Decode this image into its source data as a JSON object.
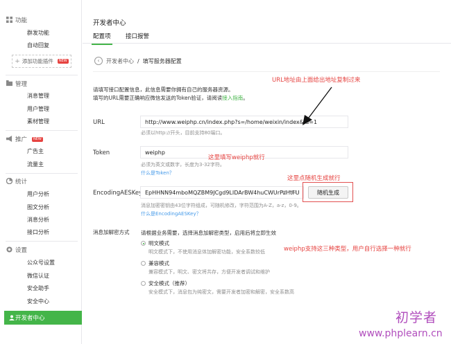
{
  "sidebar": {
    "groups": [
      {
        "title": "功能",
        "icon": "grid-icon",
        "items": [
          "群发功能",
          "自动回复"
        ]
      },
      {
        "title": "管理",
        "icon": "folder-icon",
        "items": [
          "消息管理",
          "用户管理",
          "素材管理"
        ]
      },
      {
        "title": "推广",
        "icon": "megaphone-icon",
        "badge": "NEW",
        "items": [
          "广告主",
          "流量主"
        ]
      },
      {
        "title": "统计",
        "icon": "chart-icon",
        "items": [
          "用户分析",
          "图文分析",
          "消息分析",
          "接口分析"
        ]
      },
      {
        "title": "设置",
        "icon": "gear-icon",
        "items": [
          "公众号设置",
          "微信认证",
          "安全助手",
          "安全中心"
        ]
      }
    ],
    "add_plugin": {
      "label": "添加功能插件",
      "badge": "NEW"
    },
    "active_item": "开发者中心",
    "accent": "#44b549"
  },
  "main": {
    "title": "开发者中心",
    "tabs": [
      {
        "label": "配置项"
      },
      {
        "label": "接口报警"
      }
    ],
    "breadcrumb": {
      "parent": "开发者中心",
      "separator": "/",
      "current": "填写服务器配置"
    },
    "intro_line1": "请填写接口配置信息，此信息需要你拥有自己的服务器资源。",
    "intro_line2_prefix": "填写的URL需要正确响应微信发送的Token验证，请阅读",
    "intro_link": "接入指南",
    "intro_suffix": "。",
    "url": {
      "label": "URL",
      "value": "http://www.weiphp.cn/index.php?s=/home/weixin/index&id=1",
      "hint": "必须以http://开头，目前支持80端口。"
    },
    "token": {
      "label": "Token",
      "value": "weiphp",
      "hint": "必须为英文或数字，长度为3-32字符。",
      "link": "什么是Token？"
    },
    "aes": {
      "label": "EncodingAESKey",
      "value": "EpHHNN94mboMQZBM9JCgd9LIDArBW4huCWUrPzHtFU",
      "counter": "43 /43",
      "button": "随机生成",
      "hint": "消息加密密钥由43位字符组成，可随机修改，字符范围为A-Z，a-z，0-9。",
      "link": "什么是EncodingAESKey？"
    },
    "encrypt": {
      "label": "消息加解密方式",
      "desc": "请根据业务需要，选择消息加解密类型，启用后将立即生效",
      "options": [
        {
          "label": "明文模式",
          "desc": "明文模式下，不使用消息体加解密功能，安全系数较低",
          "checked": true
        },
        {
          "label": "兼容模式",
          "desc": "兼容模式下，明文、密文将共存，方便开发者调试和维护",
          "checked": false
        },
        {
          "label": "安全模式（推荐）",
          "desc": "安全模式下，消息包为纯密文，需要开发者加密和解密，安全系数高",
          "checked": false
        }
      ]
    }
  },
  "annotations": {
    "url_note": "URL地址由上面给出地址复制过来",
    "token_note": "这里填写weiphp就行",
    "random_note": "这里点随机生成就行",
    "mode_note": "weiphp支持这三种类型，用户自行选择一种就行",
    "color": "#e64340"
  },
  "watermark": {
    "line1": "初学者",
    "line2": "www.phplearn.cn"
  }
}
